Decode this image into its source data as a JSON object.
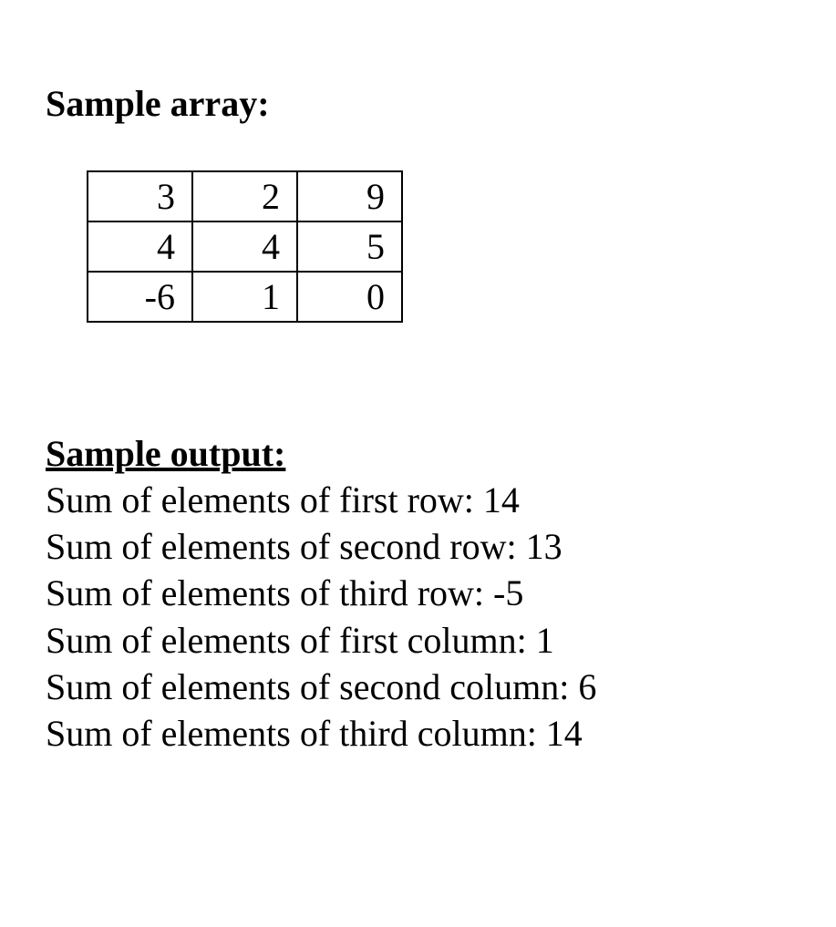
{
  "headings": {
    "sample_array": "Sample array:",
    "sample_output": "Sample output:"
  },
  "array": {
    "rows": [
      [
        "3",
        "2",
        "9"
      ],
      [
        "4",
        "4",
        "5"
      ],
      [
        "-6",
        "1",
        "0"
      ]
    ]
  },
  "output_lines": [
    "Sum of elements of first row: 14",
    "Sum of elements of second row: 13",
    "Sum of elements of third row: -5",
    "Sum of elements of first column: 1",
    "Sum of elements of second column: 6",
    "Sum of elements of third column: 14"
  ]
}
